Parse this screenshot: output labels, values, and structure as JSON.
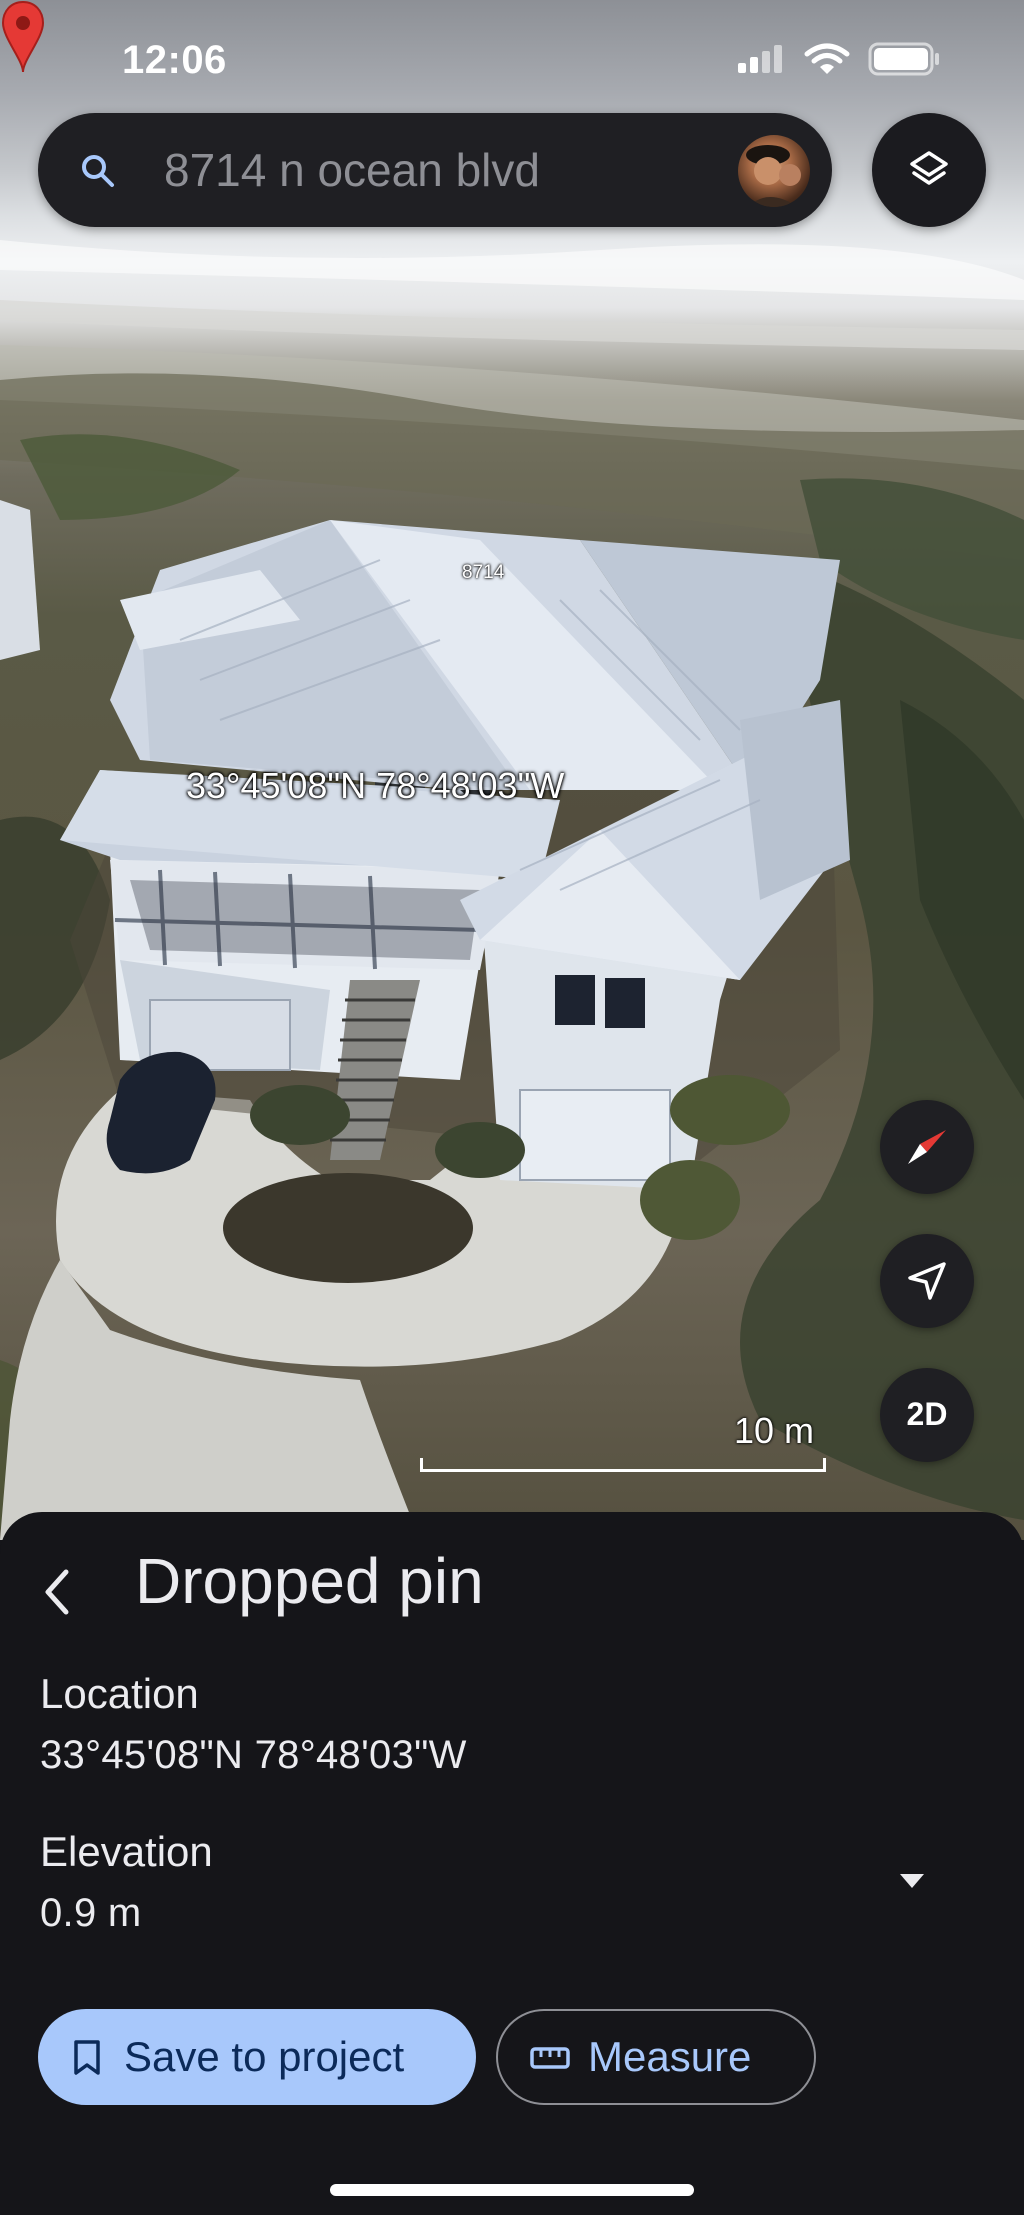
{
  "status_bar": {
    "time": "12:06"
  },
  "search": {
    "query": "8714 n ocean blvd"
  },
  "map": {
    "house_number": "8714",
    "pin_coordinates": "33°45'08\"N 78°48'03\"W",
    "scale_label": "10 m",
    "view_toggle_label": "2D"
  },
  "sheet": {
    "title": "Dropped pin",
    "location_label": "Location",
    "location_value": "33°45'08\"N 78°48'03\"W",
    "elevation_label": "Elevation",
    "elevation_value": "0.9 m",
    "save_button_label": "Save to project",
    "measure_button_label": "Measure"
  },
  "colors": {
    "sheet_background": "#151519",
    "primary_button": "#a8c8fb",
    "primary_button_text": "#0b2a59",
    "pin": "#e53935"
  },
  "icons": {
    "search": "search-icon",
    "layers": "layers-icon",
    "compass": "compass-icon",
    "location": "navigation-arrow-icon",
    "back": "chevron-left-icon",
    "dropdown": "caret-down-icon",
    "save": "bookmark-icon",
    "measure": "ruler-icon"
  }
}
